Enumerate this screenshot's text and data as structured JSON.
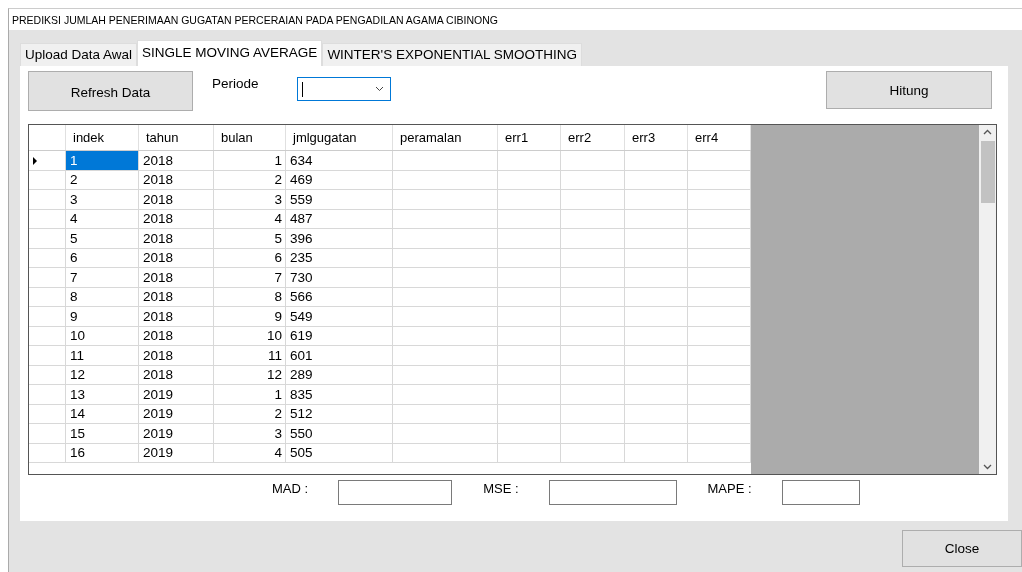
{
  "window": {
    "title": "PREDIKSI JUMLAH PENERIMAAN GUGATAN PERCERAIAN PADA PENGADILAN AGAMA CIBINONG"
  },
  "tabs": [
    {
      "label": "Upload Data Awal",
      "selected": false
    },
    {
      "label": "SINGLE MOVING AVERAGE",
      "selected": true
    },
    {
      "label": "WINTER'S EXPONENTIAL SMOOTHING",
      "selected": false
    }
  ],
  "refresh_button": "Refresh Data",
  "periode": {
    "label": "Periode"
  },
  "hitung_button": "Hitung",
  "table": {
    "columns": [
      "indek",
      "tahun",
      "bulan",
      "jmlgugatan",
      "peramalan",
      "err1",
      "err2",
      "err3",
      "err4"
    ],
    "rows": [
      {
        "indek": "1",
        "tahun": "2018",
        "bulan": "1",
        "jmlgugatan": "634",
        "selected": true
      },
      {
        "indek": "2",
        "tahun": "2018",
        "bulan": "2",
        "jmlgugatan": "469",
        "selected": false
      },
      {
        "indek": "3",
        "tahun": "2018",
        "bulan": "3",
        "jmlgugatan": "559",
        "selected": false
      },
      {
        "indek": "4",
        "tahun": "2018",
        "bulan": "4",
        "jmlgugatan": "487",
        "selected": false
      },
      {
        "indek": "5",
        "tahun": "2018",
        "bulan": "5",
        "jmlgugatan": "396",
        "selected": false
      },
      {
        "indek": "6",
        "tahun": "2018",
        "bulan": "6",
        "jmlgugatan": "235",
        "selected": false
      },
      {
        "indek": "7",
        "tahun": "2018",
        "bulan": "7",
        "jmlgugatan": "730",
        "selected": false
      },
      {
        "indek": "8",
        "tahun": "2018",
        "bulan": "8",
        "jmlgugatan": "566",
        "selected": false
      },
      {
        "indek": "9",
        "tahun": "2018",
        "bulan": "9",
        "jmlgugatan": "549",
        "selected": false
      },
      {
        "indek": "10",
        "tahun": "2018",
        "bulan": "10",
        "jmlgugatan": "619",
        "selected": false
      },
      {
        "indek": "11",
        "tahun": "2018",
        "bulan": "11",
        "jmlgugatan": "601",
        "selected": false
      },
      {
        "indek": "12",
        "tahun": "2018",
        "bulan": "12",
        "jmlgugatan": "289",
        "selected": false
      },
      {
        "indek": "13",
        "tahun": "2019",
        "bulan": "1",
        "jmlgugatan": "835",
        "selected": false
      },
      {
        "indek": "14",
        "tahun": "2019",
        "bulan": "2",
        "jmlgugatan": "512",
        "selected": false
      },
      {
        "indek": "15",
        "tahun": "2019",
        "bulan": "3",
        "jmlgugatan": "550",
        "selected": false
      },
      {
        "indek": "16",
        "tahun": "2019",
        "bulan": "4",
        "jmlgugatan": "505",
        "selected": false
      }
    ]
  },
  "metrics": [
    {
      "label": "MAD :"
    },
    {
      "label": "MSE :"
    },
    {
      "label": "MAPE :"
    }
  ],
  "close_button": "Close"
}
